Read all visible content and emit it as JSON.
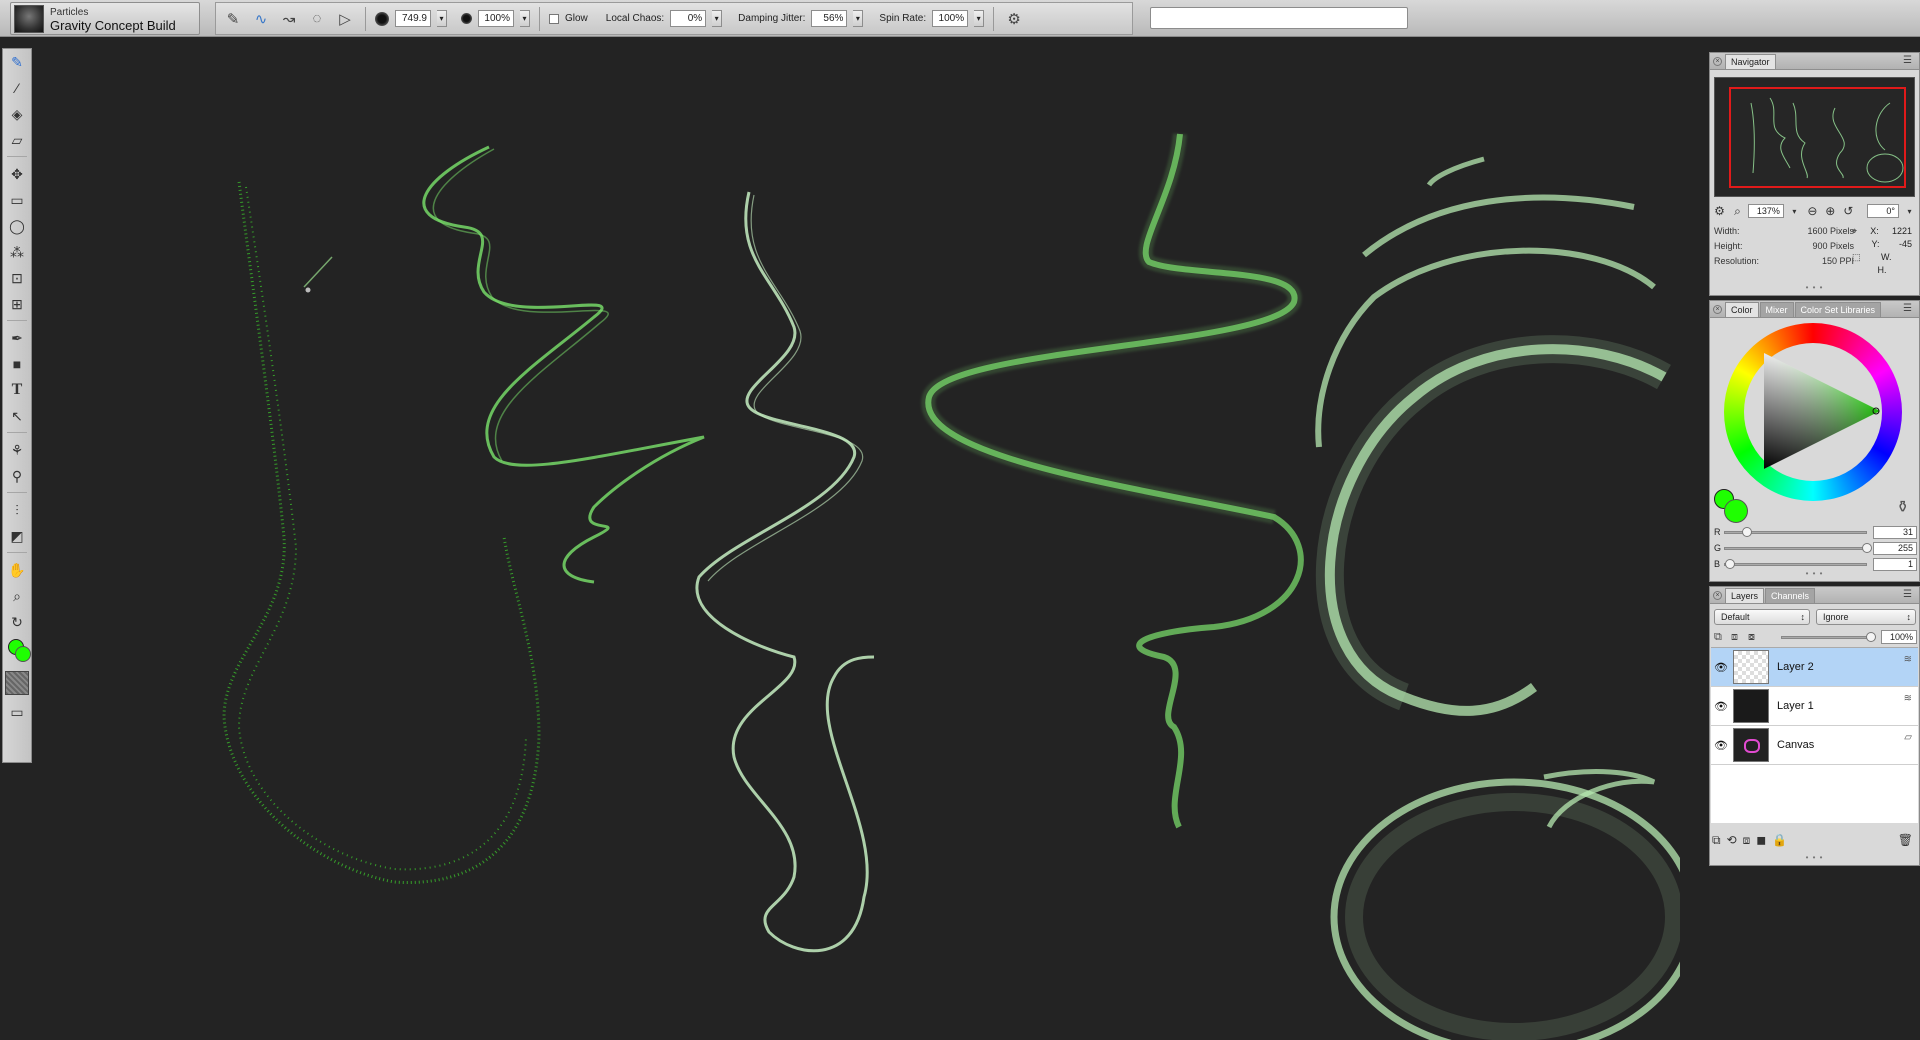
{
  "brush": {
    "category": "Particles",
    "variant": "Gravity Concept Build"
  },
  "property_bar": {
    "size_value": "749.9",
    "opacity_value": "100%",
    "glow_label": "Glow",
    "local_chaos_label": "Local Chaos:",
    "local_chaos_value": "0%",
    "damping_jitter_label": "Damping Jitter:",
    "damping_jitter_value": "56%",
    "spin_rate_label": "Spin Rate:",
    "spin_rate_value": "100%"
  },
  "search": {
    "placeholder": ""
  },
  "navigator": {
    "tab_label": "Navigator",
    "zoom_value": "137%",
    "rotation_value": "0°",
    "width_label": "Width:",
    "width_value": "1600 Pixels",
    "height_label": "Height:",
    "height_value": "900 Pixels",
    "resolution_label": "Resolution:",
    "resolution_value": "150 PPI",
    "x_label": "X:",
    "x_value": "1221",
    "y_label": "Y:",
    "y_value": "-45",
    "w_label": "W.",
    "h_label": "H."
  },
  "color_panel": {
    "tabs": [
      "Color",
      "Mixer",
      "Color Set Libraries"
    ],
    "r_label": "R",
    "r_value": "31",
    "g_label": "G",
    "g_value": "255",
    "b_label": "B",
    "b_value": "1",
    "main_color": "#1FFF01"
  },
  "layers_panel": {
    "tabs": [
      "Layers",
      "Channels"
    ],
    "composite_method": "Default",
    "composite_depth": "Ignore",
    "opacity_value": "100%",
    "layers": [
      {
        "name": "Layer 2",
        "selected": true
      },
      {
        "name": "Layer 1",
        "selected": false
      },
      {
        "name": "Canvas",
        "selected": false
      }
    ]
  },
  "colors": {
    "stroke_green": "#9fe8a0",
    "bright_green": "#3fd12e",
    "canvas_bg": "#232323",
    "selection_blue": "#b3d4f6",
    "nav_rect": "#e11a1a"
  }
}
